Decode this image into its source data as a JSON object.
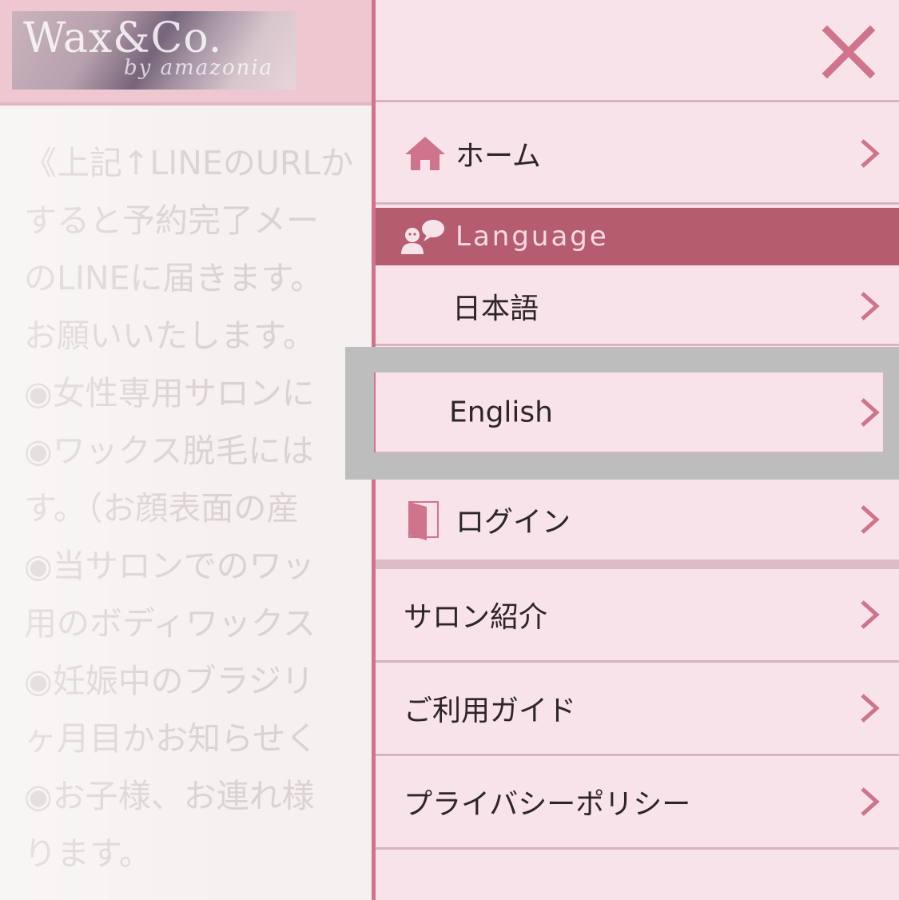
{
  "background": {
    "logo": {
      "main": "Wax&Co.",
      "sub": "by amazonia"
    },
    "lines": [
      "《上記↑LINEのURLか",
      "すると予約完了メー",
      "のLINEに届きます。",
      "お願いいたします。",
      "◉女性専用サロンに",
      "◉ワックス脱毛には",
      "す。（お顔表面の産",
      "◉当サロンでのワッ",
      "用のボディワックス",
      "◉妊娠中のブラジリ",
      "ヶ月目かお知らせく",
      "◉お子様、お連れ様",
      "ります。"
    ]
  },
  "menu": {
    "home": "ホーム",
    "language_header": "Language",
    "japanese": "日本語",
    "english": "English",
    "login": "ログイン",
    "salon": "サロン紹介",
    "guide": "ご利用ガイド",
    "privacy": "プライバシーポリシー"
  },
  "colors": {
    "accent": "#d0748c",
    "language_bar": "#b65c6f",
    "menu_bg": "#f9e3ea",
    "highlight_frame": "#bdbdbd"
  },
  "icons": {
    "close": "close-icon",
    "home": "home-icon",
    "language": "language-chat-icon",
    "login": "door-icon",
    "chevron": "chevron-right-icon"
  }
}
